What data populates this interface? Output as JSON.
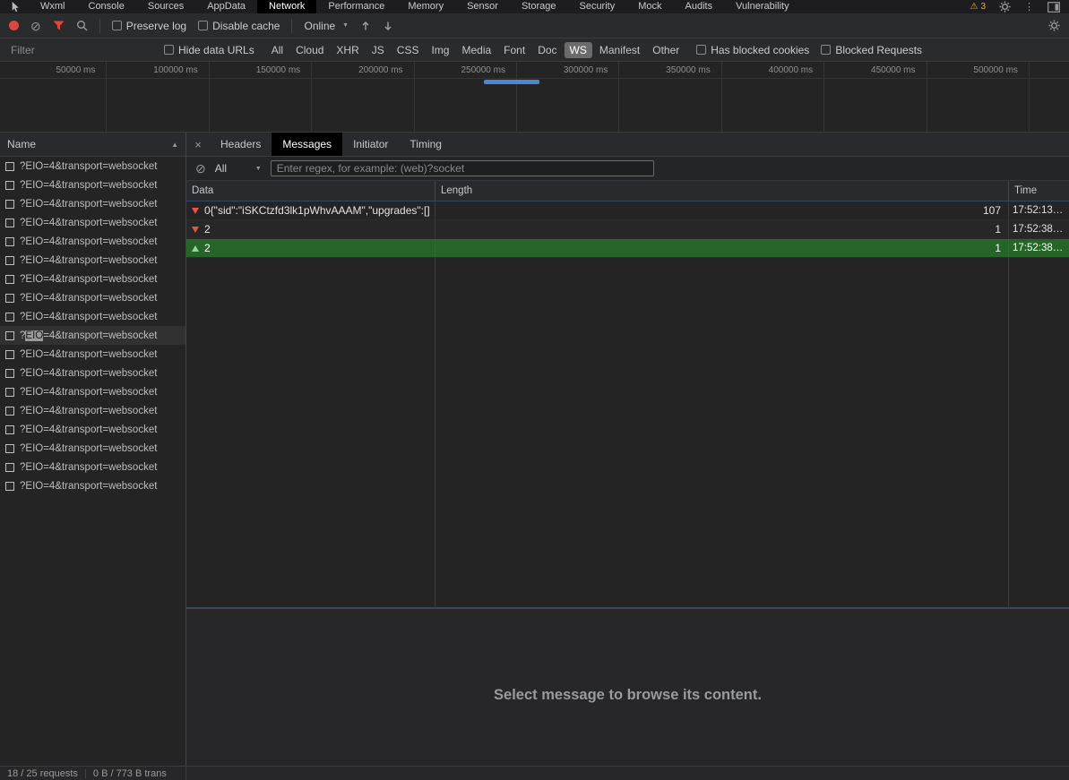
{
  "icons": {
    "warning": "⚠",
    "block": "⊘",
    "more_vert": "⋮",
    "caret_down": "▼",
    "sort_asc": "▲",
    "close": "×"
  },
  "colors": {
    "accent_blue": "#4e86d4",
    "selected_sent_green": "#256628",
    "received_arrow_red": "#e0564a",
    "sent_arrow_green": "#8fd69a",
    "warning_yellow": "#f2b10e",
    "record_red": "#d84840"
  },
  "top_tabs": {
    "items": [
      "Wxml",
      "Console",
      "Sources",
      "AppData",
      "Network",
      "Performance",
      "Memory",
      "Sensor",
      "Storage",
      "Security",
      "Mock",
      "Audits",
      "Vulnerability"
    ],
    "active": "Network",
    "warning_count": "3"
  },
  "toolbar": {
    "preserve_log_label": "Preserve log",
    "disable_cache_label": "Disable cache",
    "throttling_value": "Online"
  },
  "filter_bar": {
    "filter_placeholder": "Filter",
    "hide_data_urls_label": "Hide data URLs",
    "pills": [
      "All",
      "Cloud",
      "XHR",
      "JS",
      "CSS",
      "Img",
      "Media",
      "Font",
      "Doc",
      "WS",
      "Manifest",
      "Other"
    ],
    "active_pill": "WS",
    "has_blocked_cookies_label": "Has blocked cookies",
    "blocked_requests_label": "Blocked Requests"
  },
  "timeline": {
    "ticks": [
      "50000 ms",
      "100000 ms",
      "150000 ms",
      "200000 ms",
      "250000 ms",
      "300000 ms",
      "350000 ms",
      "400000 ms",
      "450000 ms",
      "500000 ms"
    ]
  },
  "requests": {
    "header_label": "Name",
    "rows": [
      "?EIO=4&transport=websocket",
      "?EIO=4&transport=websocket",
      "?EIO=4&transport=websocket",
      "?EIO=4&transport=websocket",
      "?EIO=4&transport=websocket",
      "?EIO=4&transport=websocket",
      "?EIO=4&transport=websocket",
      "?EIO=4&transport=websocket",
      "?EIO=4&transport=websocket",
      "?EIO=4&transport=websocket",
      "?EIO=4&transport=websocket",
      "?EIO=4&transport=websocket",
      "?EIO=4&transport=websocket",
      "?EIO=4&transport=websocket",
      "?EIO=4&transport=websocket",
      "?EIO=4&transport=websocket",
      "?EIO=4&transport=websocket",
      "?EIO=4&transport=websocket"
    ],
    "highlight_index": 9,
    "highlight": {
      "pre": "?",
      "match": "EIO",
      "post": "=4&transport=websocket"
    }
  },
  "detail": {
    "tabs": [
      "Headers",
      "Messages",
      "Initiator",
      "Timing"
    ],
    "active_tab": "Messages",
    "message_filter_value": "All",
    "regex_placeholder": "Enter regex, for example: (web)?socket",
    "table": {
      "columns": [
        "Data",
        "Length",
        "Time"
      ],
      "rows": [
        {
          "direction": "received",
          "data": "0{\"sid\":\"iSKCtzfd3lk1pWhvAAAM\",\"upgrades\":[]…",
          "length": "107",
          "time": "17:52:13…",
          "selected": false
        },
        {
          "direction": "received",
          "data": "2",
          "length": "1",
          "time": "17:52:38…",
          "selected": false
        },
        {
          "direction": "sent",
          "data": "2",
          "length": "1",
          "time": "17:52:38…",
          "selected": true
        }
      ]
    },
    "empty_message": "Select message to browse its content."
  },
  "status_bar": {
    "requests_label": "18 / 25 requests",
    "transferred_label": "0 B / 773 B trans"
  }
}
